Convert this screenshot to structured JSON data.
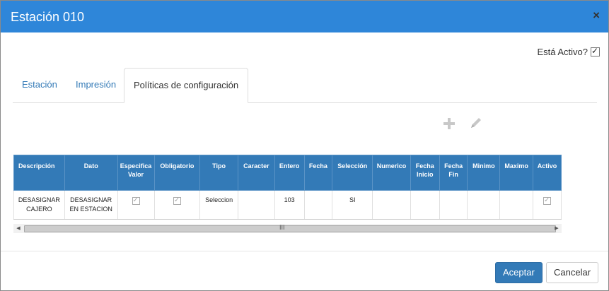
{
  "dialog": {
    "title": "Estación 010",
    "close_symbol": "×"
  },
  "active": {
    "label": "Está Activo?",
    "checked": true
  },
  "tabs": [
    {
      "label": "Estación"
    },
    {
      "label": "Impresión"
    },
    {
      "label": "Políticas de configuración",
      "active": true
    }
  ],
  "toolbar": {
    "add_icon": "plus-icon",
    "edit_icon": "pencil-icon"
  },
  "table": {
    "headers": [
      "Descripción",
      "Dato",
      "Especifica Valor",
      "Obligatorio",
      "Tipo",
      "Caracter",
      "Entero",
      "Fecha",
      "Selección",
      "Numerico",
      "Fecha Inicio",
      "Fecha Fin",
      "Minimo",
      "Maximo",
      "Activo"
    ],
    "rows": [
      {
        "descripcion": "DESASIGNAR CAJERO",
        "dato": "DESASIGNAR EN ESTACION",
        "especifica_valor": true,
        "obligatorio": true,
        "tipo": "Seleccion",
        "caracter": "",
        "entero": "103",
        "fecha": "",
        "seleccion": "SI",
        "numerico": "",
        "fecha_inicio": "",
        "fecha_fin": "",
        "minimo": "",
        "maximo": "",
        "activo": true
      }
    ]
  },
  "scrollbar": {
    "grip": "III"
  },
  "footer": {
    "accept_label": "Aceptar",
    "cancel_label": "Cancelar"
  }
}
